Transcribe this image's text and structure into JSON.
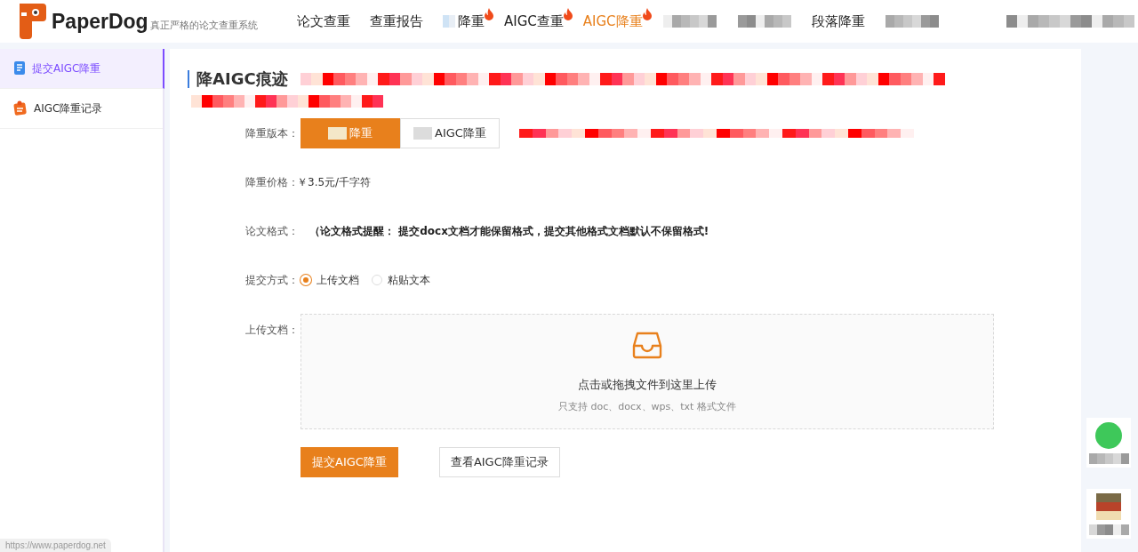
{
  "header": {
    "logo": "PaperDog",
    "slogan": "真正严格的论文查重系统",
    "nav": [
      {
        "kind": "text",
        "label": "论文查重",
        "selected": false,
        "hot": false
      },
      {
        "kind": "text",
        "label": "查重报告",
        "selected": false,
        "hot": false
      },
      {
        "kind": "partial",
        "label": "降重",
        "selected": false,
        "hot": true
      },
      {
        "kind": "text",
        "label": "AIGC查重",
        "selected": false,
        "hot": true
      },
      {
        "kind": "text",
        "label": "AIGC降重",
        "selected": true,
        "hot": true
      },
      {
        "kind": "pixelated"
      },
      {
        "kind": "pixelated"
      },
      {
        "kind": "text",
        "label": "段落降重",
        "selected": false,
        "hot": false
      },
      {
        "kind": "pixelated"
      }
    ]
  },
  "sidebar": {
    "items": [
      {
        "label": "提交AIGC降重",
        "selected": true
      },
      {
        "label": "AIGC降重记录",
        "selected": false
      }
    ]
  },
  "main": {
    "title": "降AIGC痕迹",
    "version": {
      "label": "降重版本：",
      "options": [
        {
          "label": "降重",
          "selected": true
        },
        {
          "label": "AIGC降重",
          "selected": false
        }
      ]
    },
    "price": {
      "label": "降重价格：",
      "value": "￥3.5元/千字符"
    },
    "format": {
      "label": "论文格式：",
      "notice": "（论文格式提醒： 提交docx文档才能保留格式，提交其他格式文档默认不保留格式!"
    },
    "method": {
      "label": "提交方式：",
      "options": [
        {
          "label": "上传文档",
          "selected": true
        },
        {
          "label": "粘贴文本",
          "selected": false
        }
      ]
    },
    "upload": {
      "label": "上传文档：",
      "prompt": "点击或拖拽文件到这里上传",
      "hint": "只支持 doc、docx、wps、txt 格式文件"
    },
    "buttons": [
      {
        "label": "提交AIGC降重",
        "kind": "primary"
      },
      {
        "label": "查看AIGC降重记录",
        "kind": "default"
      }
    ]
  },
  "status_bar": {
    "url": "https://www.paperdog.net"
  }
}
